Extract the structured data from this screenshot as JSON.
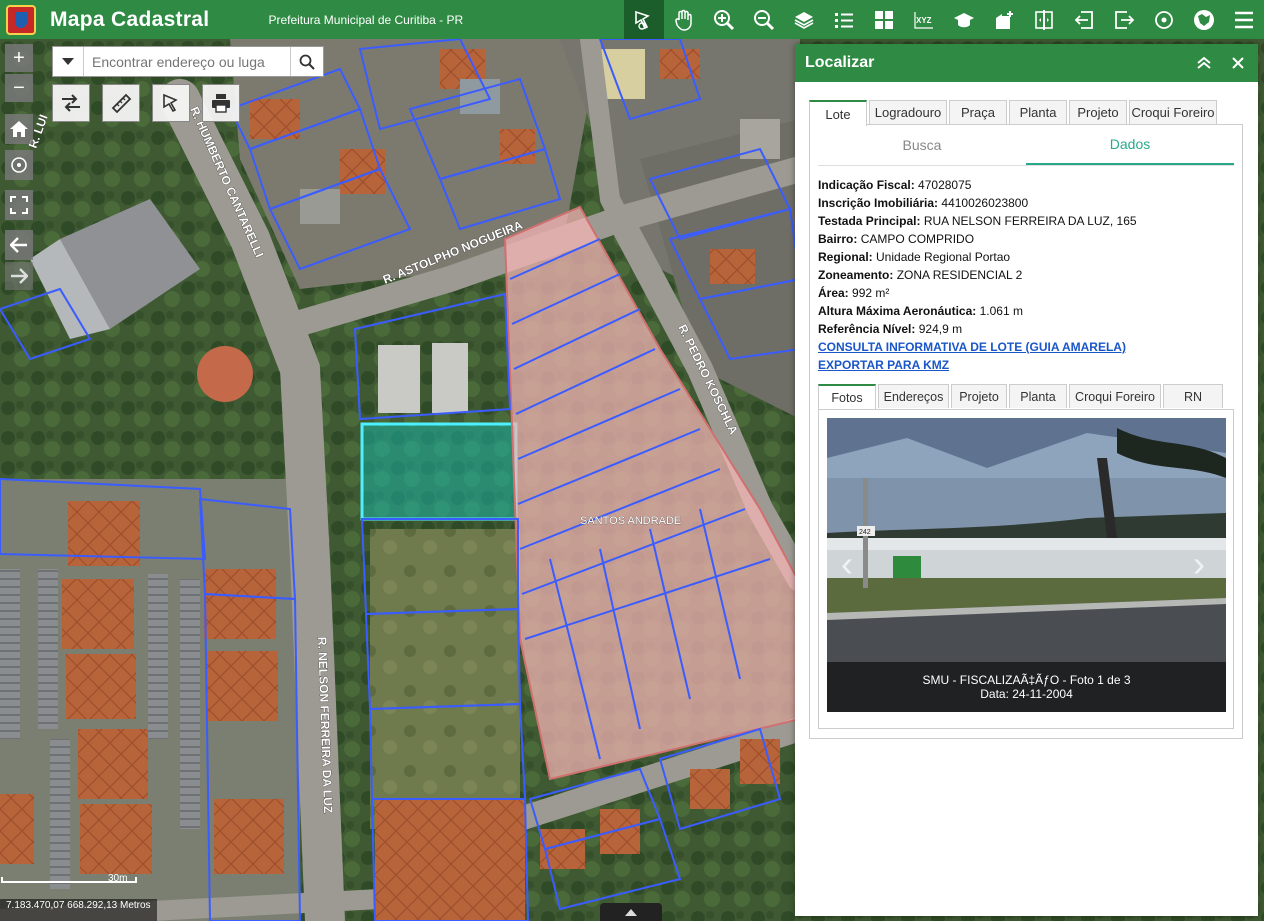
{
  "header": {
    "title": "Mapa Cadastral",
    "subtitle": "Prefeitura Municipal de Curitiba - PR",
    "tools": [
      {
        "icon": "identify-icon",
        "active": true
      },
      {
        "icon": "pan-hand-icon"
      },
      {
        "icon": "zoom-in-icon"
      },
      {
        "icon": "zoom-out-icon"
      },
      {
        "icon": "layers-icon"
      },
      {
        "icon": "legend-list-icon"
      },
      {
        "icon": "basemap-grid-icon"
      },
      {
        "icon": "xyz-coordinates-icon",
        "label": "XYZ"
      },
      {
        "icon": "graduation-cap-icon"
      },
      {
        "icon": "add-location-icon"
      },
      {
        "icon": "swipe-compare-icon"
      },
      {
        "icon": "login-icon"
      },
      {
        "icon": "logout-icon"
      },
      {
        "icon": "target-icon"
      },
      {
        "icon": "map-pin-icon"
      },
      {
        "icon": "menu-icon"
      }
    ]
  },
  "search": {
    "placeholder": "Encontrar endereço ou luga"
  },
  "map": {
    "street_labels": [
      "R. HUMBERTO CANTARELLI",
      "R. ASTOLPHO NOGUEIRA",
      "R. PEDRO KOSCHLA",
      "R. NELSON FERREIRA DA LUZ",
      "R. LUI"
    ],
    "area_label": "SANTOS ANDRADE",
    "scale_label": "30m",
    "coordinates": "7.183.470,07 668.292,13 Metros",
    "colors": {
      "parcel_line": "#3b5cff",
      "selected_fill": "#1ab4a6",
      "selected_line": "#4df0ff",
      "condo_fill": "#f3b4b4"
    }
  },
  "panel": {
    "title": "Localizar",
    "tabs": [
      "Lote",
      "Logradouro",
      "Praça",
      "Planta",
      "Projeto",
      "Croqui Foreiro"
    ],
    "active_tab": "Lote",
    "subtabs": [
      "Busca",
      "Dados"
    ],
    "active_subtab": "Dados",
    "fields": [
      {
        "label": "Indicação Fiscal:",
        "value": "47028075"
      },
      {
        "label": "Inscrição Imobiliária:",
        "value": "4410026023800"
      },
      {
        "label": "Testada Principal:",
        "value": "RUA NELSON FERREIRA DA LUZ, 165"
      },
      {
        "label": "Bairro:",
        "value": "CAMPO COMPRIDO"
      },
      {
        "label": "Regional:",
        "value": "Unidade Regional Portao"
      },
      {
        "label": "Zoneamento:",
        "value": "ZONA RESIDENCIAL 2"
      },
      {
        "label": "Área:",
        "value": "992 m²"
      },
      {
        "label": "Altura Máxima Aeronáutica:",
        "value": "1.061 m"
      },
      {
        "label": "Referência Nível:",
        "value": "924,9 m"
      }
    ],
    "links": [
      "CONSULTA INFORMATIVA DE LOTE (GUIA AMARELA)",
      "EXPORTAR PARA KMZ"
    ],
    "photo_tabs": [
      "Fotos",
      "Endereços",
      "Projeto",
      "Planta",
      "Croqui Foreiro",
      "RN"
    ],
    "photo": {
      "caption_line1": "SMU - FISCALIZAÃ‡ÃƒO - Foto 1 de 3",
      "caption_line2": "Data: 24-11-2004",
      "sign_number": "242"
    }
  }
}
